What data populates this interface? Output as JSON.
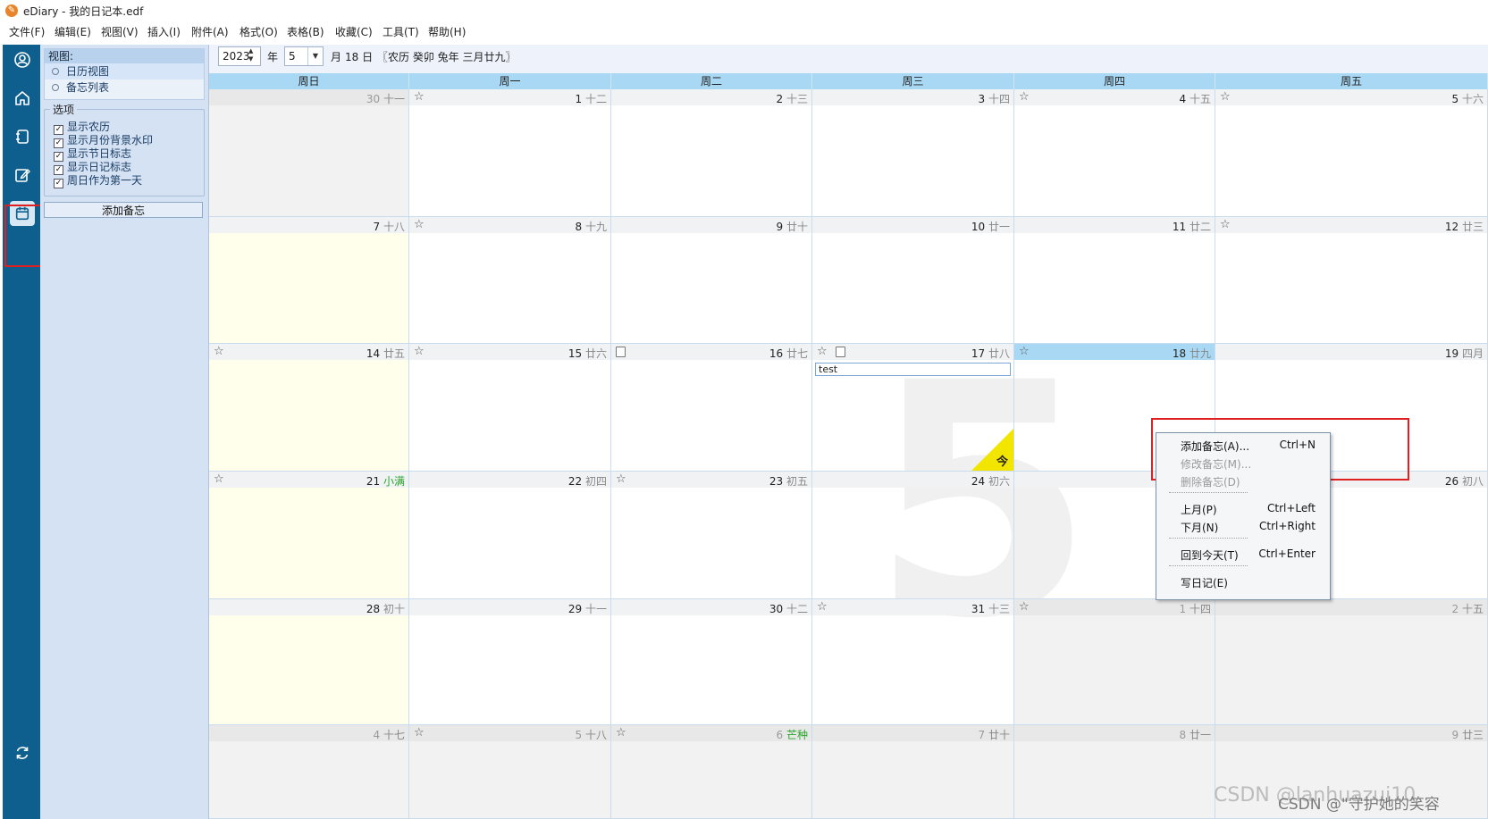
{
  "window": {
    "app_icon": "ediary-feather-icon",
    "title": "eDiary - 我的日记本.edf"
  },
  "menu": [
    "文件(F)",
    "编辑(E)",
    "视图(V)",
    "插入(I)",
    "附件(A)",
    "格式(O)",
    "表格(B)",
    "收藏(C)",
    "工具(T)",
    "帮助(H)"
  ],
  "sidebar_icons": [
    "user-icon",
    "home-icon",
    "diary-book-icon",
    "edit-icon",
    "calendar-icon",
    "sync-icon"
  ],
  "panel": {
    "view_header": "视图:",
    "views": [
      "日历视图",
      "备忘列表"
    ],
    "options_legend": "选项",
    "options": [
      "显示农历",
      "显示月份背景水印",
      "显示节日标志",
      "显示日记标志",
      "周日作为第一天"
    ],
    "add_memo_button": "添加备忘"
  },
  "nav": {
    "year": "2023",
    "year_unit": "年",
    "month": "5",
    "month_unit": "月",
    "day_unit": "18 日",
    "lunar_info": "〖农历 癸卯 兔年 三月廿九〗"
  },
  "weekdays": [
    "周日",
    "周一",
    "周二",
    "周三",
    "周四",
    "周五"
  ],
  "watermark_month": "5",
  "weeks": [
    [
      {
        "day": "30",
        "lunar": "十一",
        "other": true
      },
      {
        "day": "1",
        "lunar": "十二",
        "star": true
      },
      {
        "day": "2",
        "lunar": "十三"
      },
      {
        "day": "3",
        "lunar": "十四"
      },
      {
        "day": "4",
        "lunar": "十五",
        "star": true
      },
      {
        "day": "5",
        "lunar": "十六",
        "star": true
      }
    ],
    [
      {
        "day": "7",
        "lunar": "十八"
      },
      {
        "day": "8",
        "lunar": "十九",
        "star": true
      },
      {
        "day": "9",
        "lunar": "廿十"
      },
      {
        "day": "10",
        "lunar": "廿一"
      },
      {
        "day": "11",
        "lunar": "廿二"
      },
      {
        "day": "12",
        "lunar": "廿三",
        "star": true
      }
    ],
    [
      {
        "day": "14",
        "lunar": "廿五",
        "star": true
      },
      {
        "day": "15",
        "lunar": "廿六",
        "star": true
      },
      {
        "day": "16",
        "lunar": "廿七",
        "note": true
      },
      {
        "day": "17",
        "lunar": "廿八",
        "star": true,
        "note": true,
        "memo": "test"
      },
      {
        "day": "18",
        "lunar": "廿九",
        "star": true,
        "today": true
      },
      {
        "day": "19",
        "lunar": "四月"
      }
    ],
    [
      {
        "day": "21",
        "lunar": "小满",
        "term": true,
        "star": true
      },
      {
        "day": "22",
        "lunar": "初四"
      },
      {
        "day": "23",
        "lunar": "初五",
        "star": true
      },
      {
        "day": "24",
        "lunar": "初六"
      },
      {
        "day": "",
        "lunar": ""
      },
      {
        "day": "26",
        "lunar": "初八"
      }
    ],
    [
      {
        "day": "28",
        "lunar": "初十"
      },
      {
        "day": "29",
        "lunar": "十一"
      },
      {
        "day": "30",
        "lunar": "十二"
      },
      {
        "day": "31",
        "lunar": "十三",
        "star": true
      },
      {
        "day": "1",
        "lunar": "十四",
        "other": true,
        "star": true
      },
      {
        "day": "2",
        "lunar": "十五",
        "other": true
      }
    ],
    [
      {
        "day": "4",
        "lunar": "十七",
        "other": true
      },
      {
        "day": "5",
        "lunar": "十八",
        "other": true,
        "star": true
      },
      {
        "day": "6",
        "lunar": "芒种",
        "other": true,
        "term": true,
        "star": true
      },
      {
        "day": "7",
        "lunar": "廿十",
        "other": true
      },
      {
        "day": "8",
        "lunar": "廿一",
        "other": true
      },
      {
        "day": "9",
        "lunar": "廿三",
        "other": true
      }
    ]
  ],
  "today_badge": "今",
  "context_menu": [
    {
      "label": "添加备忘(A)...",
      "shortcut": "Ctrl+N",
      "enabled": true
    },
    {
      "label": "修改备忘(M)...",
      "shortcut": "",
      "enabled": false
    },
    {
      "label": "删除备忘(D)",
      "shortcut": "",
      "enabled": false
    },
    {
      "label": "上月(P)",
      "shortcut": "Ctrl+Left",
      "enabled": true
    },
    {
      "label": "下月(N)",
      "shortcut": "Ctrl+Right",
      "enabled": true
    },
    {
      "label": "回到今天(T)",
      "shortcut": "Ctrl+Enter",
      "enabled": true
    },
    {
      "label": "写日记(E)",
      "shortcut": "",
      "enabled": true
    }
  ],
  "overlay_watermark": "CSDN @lanhuazui10",
  "overlay_watermark_2": "CSDN @\"守护她的笑容"
}
